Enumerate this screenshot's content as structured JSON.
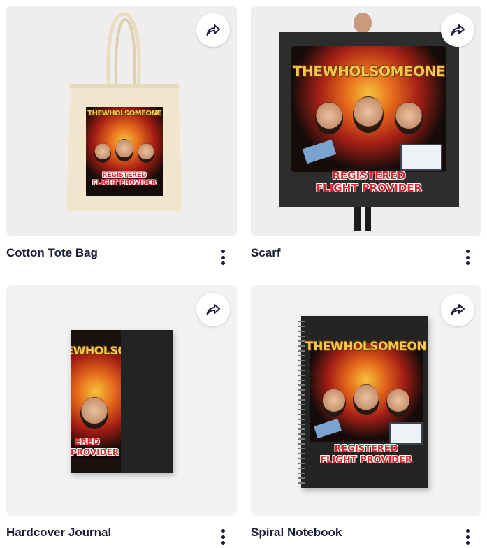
{
  "products": [
    {
      "title": "Cotton Tote Bag"
    },
    {
      "title": "Scarf"
    },
    {
      "title": "Hardcover Journal"
    },
    {
      "title": "Spiral Notebook"
    }
  ],
  "design": {
    "headline": "THEWHOLSOMEONE",
    "tagline_1": "REGISTERED",
    "tagline_2": "FLIGHT PROVIDER",
    "journal_tagline_1": "ERED",
    "journal_tagline_2": "PROVIDER"
  },
  "icons": {
    "share": "share-arrow-icon",
    "more": "kebab-menu-icon"
  },
  "colors": {
    "title_text": "#1b1b3a",
    "tile_bg": "#f2f2f2",
    "poster_gold": "#f3c94b",
    "poster_red": "#d7262c"
  }
}
